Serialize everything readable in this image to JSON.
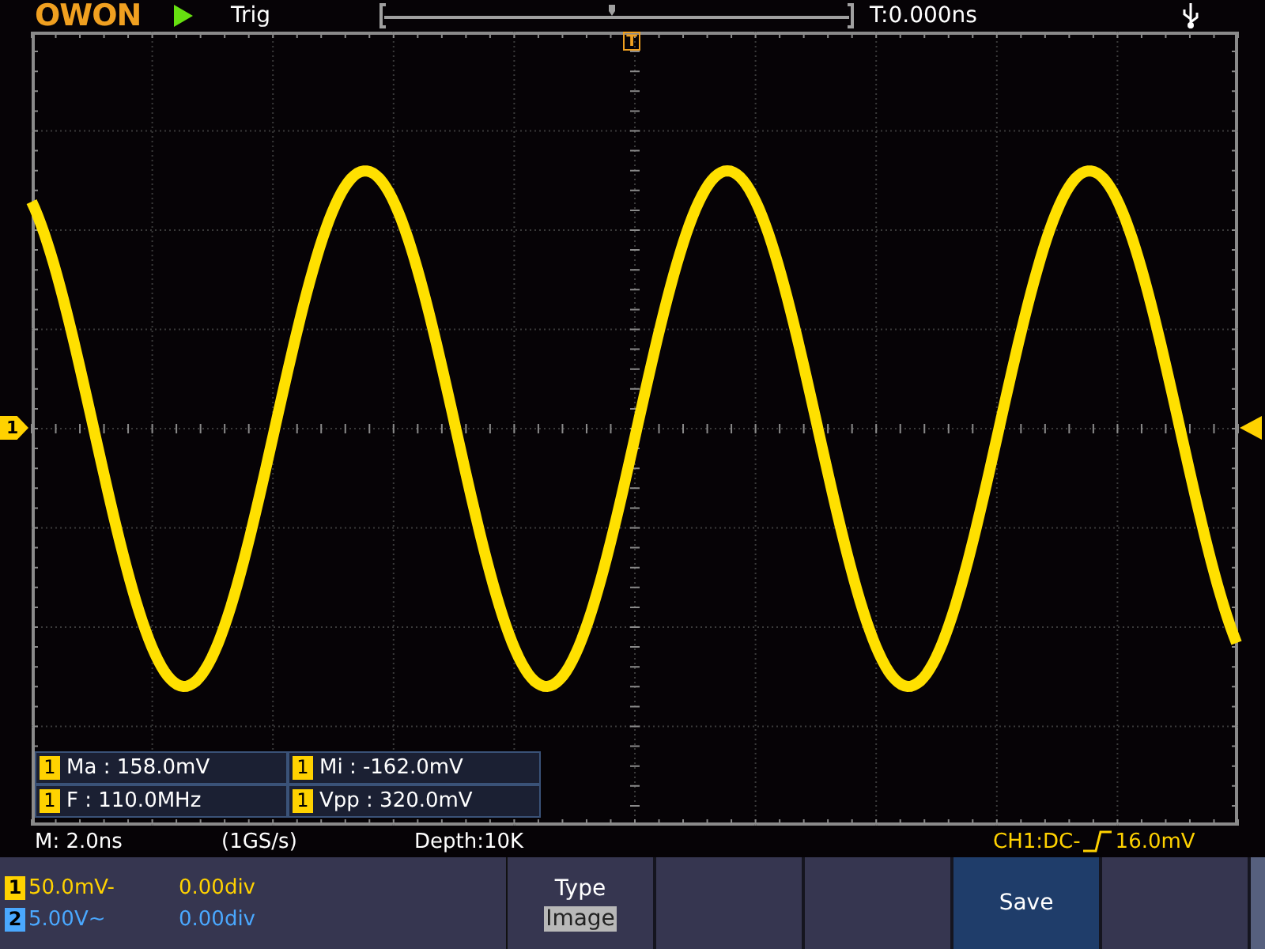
{
  "header": {
    "logo": "OWON",
    "trigger_status": "Trig",
    "time_offset": "T:0.000ns"
  },
  "screen": {
    "trigger_marker": "T",
    "channel_marker": "1"
  },
  "measurements": [
    {
      "channel": "1",
      "text": "Ma : 158.0mV"
    },
    {
      "channel": "1",
      "text": "Mi : -162.0mV"
    },
    {
      "channel": "1",
      "text": "F : 110.0MHz"
    },
    {
      "channel": "1",
      "text": "Vpp : 320.0mV"
    }
  ],
  "info": {
    "timebase": "M: 2.0ns",
    "sample_rate": "(1GS/s)",
    "depth": "Depth:10K",
    "trigger_source": "CH1:DC-",
    "trigger_level": "16.0mV"
  },
  "channels": [
    {
      "number": "1",
      "scale": "50.0mV-",
      "offset": "0.00div",
      "color": "#ffd200"
    },
    {
      "number": "2",
      "scale": "5.00V~",
      "offset": "0.00div",
      "color": "#4aa8ff"
    }
  ],
  "menu": [
    {
      "label": "Type",
      "value": "Image",
      "selected": false
    },
    {
      "selected": false
    },
    {
      "selected": false
    },
    {
      "label": "Save",
      "selected": true
    },
    {
      "selected": false
    }
  ]
}
